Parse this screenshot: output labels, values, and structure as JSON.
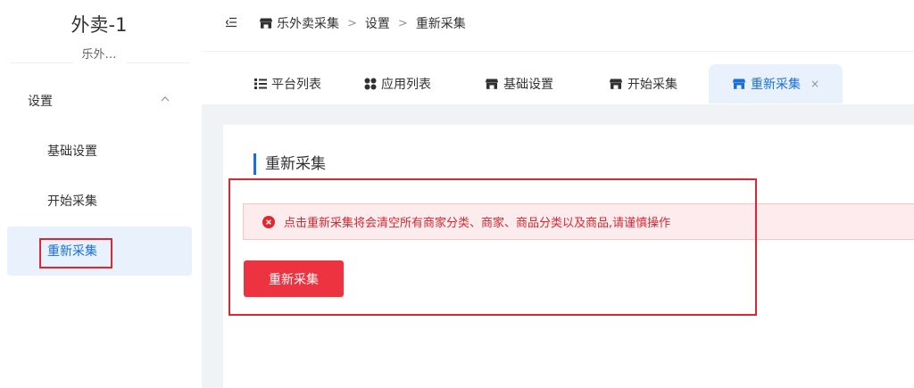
{
  "sidebar": {
    "title": "外卖-1",
    "subtitle": "乐外…",
    "group": {
      "label": "设置",
      "icon": "chevron-up-icon",
      "expanded": true
    },
    "items": [
      {
        "label": "基础设置",
        "active": false
      },
      {
        "label": "开始采集",
        "active": false
      },
      {
        "label": "重新采集",
        "active": true
      }
    ]
  },
  "topbar": {
    "collapse_icon": "menu-fold-icon",
    "breadcrumb": [
      {
        "label": "乐外卖采集",
        "icon": "shop-icon"
      },
      {
        "label": "设置"
      },
      {
        "label": "重新采集"
      }
    ],
    "separator": ">"
  },
  "tabs": [
    {
      "label": "平台列表",
      "icon": "list-icon",
      "active": false
    },
    {
      "label": "应用列表",
      "icon": "apps-icon",
      "active": false
    },
    {
      "label": "基础设置",
      "icon": "shop-icon",
      "active": false
    },
    {
      "label": "开始采集",
      "icon": "shop-icon",
      "active": false
    },
    {
      "label": "重新采集",
      "icon": "shop-icon",
      "active": true,
      "close": "×"
    }
  ],
  "main": {
    "title": "重新采集",
    "alert": {
      "icon": "error-circle-icon",
      "text": "点击重新采集将会清空所有商家分类、商家、商品分类以及商品,请谨慎操作"
    },
    "button_label": "重新采集"
  },
  "colors": {
    "accent": "#1b6fd8",
    "danger": "#ee3340",
    "alert_bg": "#fdeced",
    "active_bg": "#e8f1fc",
    "annotation": "#e0262f"
  }
}
